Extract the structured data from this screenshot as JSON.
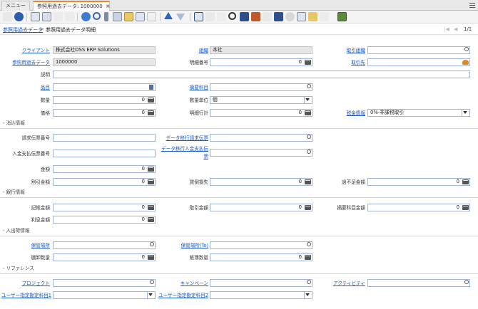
{
  "tabs": {
    "menu": "メニュー",
    "doc": "参照用過去データ: 1000000",
    "close": "×"
  },
  "crumb": {
    "parent": "参照用過去データ",
    "sep": ">",
    "current": "参照用過去データ明細",
    "pages": "1/1"
  },
  "toolbar": {
    "icons": [
      "undo-icon",
      "help-icon",
      "new-icon",
      "copy-icon",
      "delete-icon",
      "refresh-icon",
      "find-icon",
      "attachment-icon",
      "chat-icon",
      "archive-icon",
      "grid-toggle-icon",
      "mail-icon",
      "up-icon",
      "down-icon",
      "report-icon",
      "print-preview-icon",
      "zoom-across-icon",
      "request-icon",
      "product-info-icon",
      "history-icon",
      "workflow-icon",
      "print-icon",
      "customize-icon",
      "export-icon",
      "import-icon",
      "close-window-icon"
    ]
  },
  "fields": {
    "client": {
      "label": "クライアント",
      "value": "株式会社OSS ERP Solutions"
    },
    "org": {
      "label": "組織",
      "value": "本社"
    },
    "trx_org": {
      "label": "取引組織",
      "value": ""
    },
    "ref_data": {
      "label": "参照用過去データ",
      "value": "1000000"
    },
    "line_no": {
      "label": "明細番号",
      "value": "0"
    },
    "bpartner": {
      "label": "取引先",
      "value": ""
    },
    "desc": {
      "label": "説明",
      "value": ""
    },
    "product": {
      "label": "品目",
      "value": ""
    },
    "charge": {
      "label": "摘要科目",
      "value": ""
    },
    "qty": {
      "label": "数量",
      "value": "0"
    },
    "uom": {
      "label": "数量単位",
      "value": "個"
    },
    "price": {
      "label": "価格",
      "value": "0"
    },
    "line_total": {
      "label": "明細行計",
      "value": "0"
    },
    "tax": {
      "label": "税金情報",
      "value": "0%-非課税取引"
    },
    "inv_no": {
      "label": "請求伝票番号",
      "value": ""
    },
    "data_inv": {
      "label": "データ移行請求伝票",
      "value": ""
    },
    "pay_no": {
      "label": "入金支払伝票番号",
      "value": ""
    },
    "data_pay": {
      "label": "データ移行入金支払伝票",
      "value": ""
    },
    "amount": {
      "label": "金額",
      "value": "0"
    },
    "discount": {
      "label": "割引金額",
      "value": "0"
    },
    "writeoff": {
      "label": "貸倒損失",
      "value": "0"
    },
    "overunder": {
      "label": "過不足金額",
      "value": "0"
    },
    "book_amt": {
      "label": "記帳金額",
      "value": "0"
    },
    "trx_amt": {
      "label": "取引金額",
      "value": "0"
    },
    "charge_amt": {
      "label": "摘要科目金額",
      "value": "0"
    },
    "interest": {
      "label": "利息金額",
      "value": "0"
    },
    "locator": {
      "label": "保管場所",
      "value": ""
    },
    "locator_to": {
      "label": "保管場所(To)",
      "value": ""
    },
    "count_qty": {
      "label": "棚卸数量",
      "value": "0"
    },
    "book_qty": {
      "label": "帳簿数量",
      "value": "0"
    },
    "project": {
      "label": "プロジェクト",
      "value": ""
    },
    "campaign": {
      "label": "キャンペーン",
      "value": ""
    },
    "activity": {
      "label": "アクティビティ",
      "value": ""
    },
    "user1": {
      "label": "ユーザー指定勘定科目1",
      "value": ""
    },
    "user2": {
      "label": "ユーザー指定勘定科目2",
      "value": ""
    }
  },
  "sections": {
    "settle": "- 消込情報",
    "bank": "- 銀行情報",
    "inout": "- 入出荷情報",
    "ref": "- リファレンス"
  },
  "colors": {
    "accent": "#e78b2a",
    "link": "#1a56c4",
    "field_border": "#9fb5d8"
  }
}
